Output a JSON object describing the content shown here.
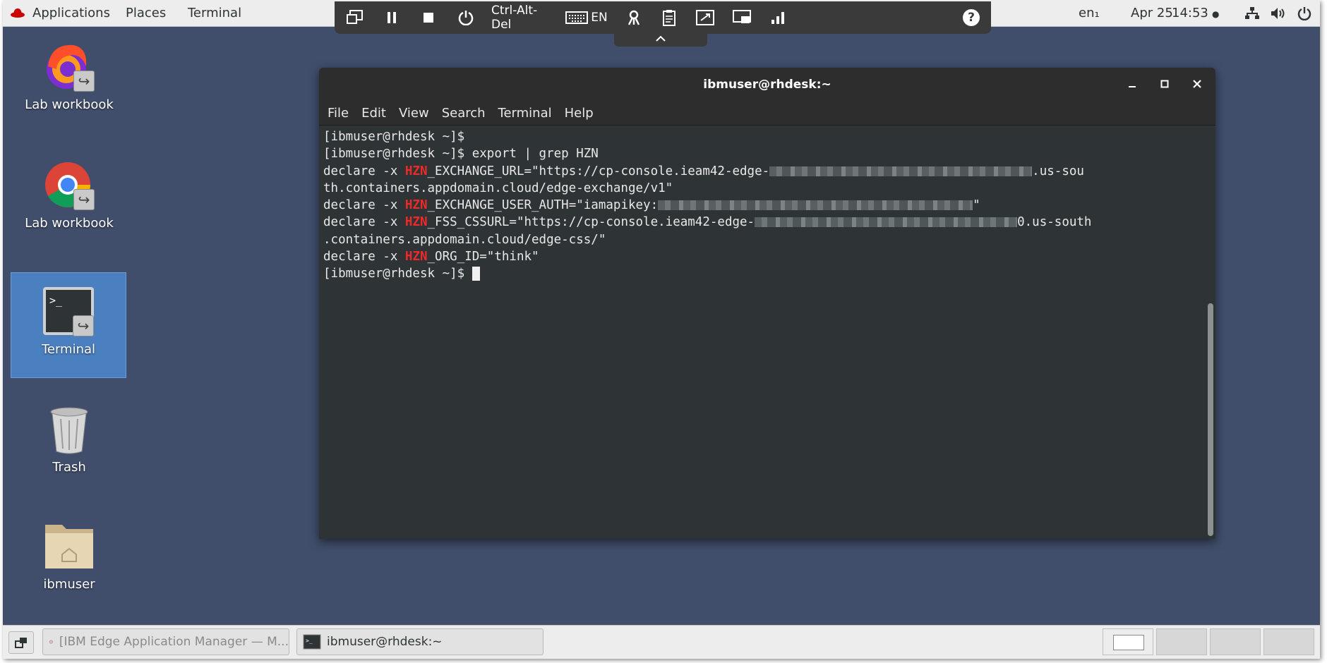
{
  "topbar": {
    "applications": "Applications",
    "places": "Places",
    "terminal": "Terminal",
    "keyboard_layout": "en₁",
    "date": "Apr 25",
    "time": "14:53"
  },
  "vnc_toolbar": {
    "ctrl_alt_del": "Ctrl-Alt-Del",
    "lang": "EN",
    "help": "?"
  },
  "desktop_icons": [
    {
      "label": "Lab workbook"
    },
    {
      "label": "Lab workbook"
    },
    {
      "label": "Terminal"
    },
    {
      "label": "Trash"
    },
    {
      "label": "ibmuser"
    }
  ],
  "window": {
    "title": "ibmuser@rhdesk:~",
    "menu": [
      "File",
      "Edit",
      "View",
      "Search",
      "Terminal",
      "Help"
    ]
  },
  "terminal": {
    "prompt": "[ibmuser@rhdesk ~]$ ",
    "command": "export | grep HZN",
    "declare": "declare -x ",
    "key": "HZN",
    "line3a": "_EXCHANGE_URL=\"https://cp-console.ieam42-edge-",
    "line3b": ".us-sou",
    "line4": "th.containers.appdomain.cloud/edge-exchange/v1\"",
    "line5a": "_EXCHANGE_USER_AUTH=\"iamapikey:",
    "line5b": "\"",
    "line6a": "_FSS_CSSURL=\"https://cp-console.ieam42-edge-",
    "line6b": "0.us-south",
    "line7": ".containers.appdomain.cloud/edge-css/\"",
    "line8": "_ORG_ID=\"think\""
  },
  "taskbar": {
    "task1": "[IBM Edge Application Manager — M...",
    "task2": "ibmuser@rhdesk:~"
  }
}
